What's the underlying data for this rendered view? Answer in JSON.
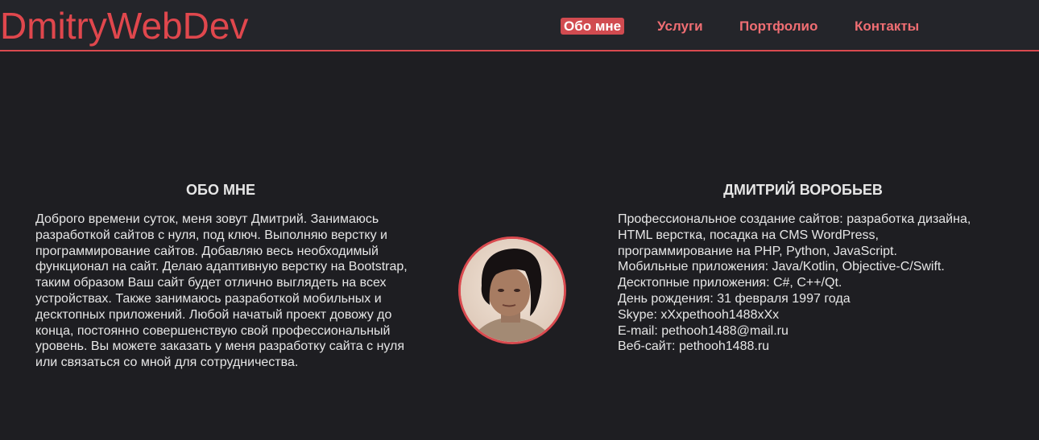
{
  "header": {
    "logo": "DmitryWebDev",
    "nav": [
      {
        "label": "Обо мне",
        "active": true
      },
      {
        "label": "Услуги",
        "active": false
      },
      {
        "label": "Портфолио",
        "active": false
      },
      {
        "label": "Контакты",
        "active": false
      }
    ]
  },
  "about": {
    "title": "ОБО МНЕ",
    "text": "Доброго времени суток, меня зовут Дмитрий. Занимаюсь разработкой сайтов с нуля, под ключ. Выполняю верстку и программирование сайтов. Добавляю весь необходимый функционал на сайт. Делаю адаптивную верстку на Bootstrap, таким образом Ваш сайт будет отлично выглядеть на всех устройствах. Также занимаюсь разработкой мобильных и десктопных приложений. Любой начатый проект довожу до конца, постоянно совершенствую свой профессиональный уровень. Вы можете заказать у меня разработку сайта с нуля или связаться со мной для сотрудничества."
  },
  "profile": {
    "title": "ДМИТРИЙ ВОРОБЬЕВ",
    "items": [
      "Профессиональное создание сайтов: разработка дизайна, HTML верстка, посадка на CMS WordPress, программирование на PHP, Python, JavaScript.",
      "Мобильные приложения: Java/Kotlin, Objective-C/Swift.",
      "Десктопные приложения: C#, C++/Qt.",
      "День рождения: 31 февраля 1997 года",
      "Skype: xXxpethooh1488xXx",
      "E-mail: pethooh1488@mail.ru",
      "Веб-сайт: pethooh1488.ru"
    ]
  },
  "colors": {
    "accent": "#d94a4f",
    "background": "#1e1e22",
    "header_bg": "#24252a",
    "text": "#e6e6e6"
  }
}
